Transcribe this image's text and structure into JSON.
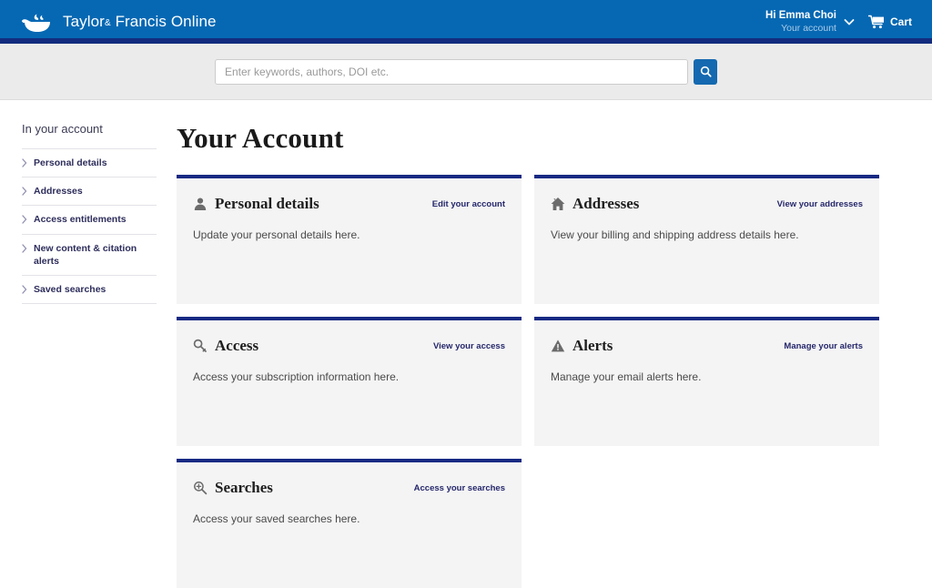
{
  "header": {
    "brand_name": "Taylor",
    "brand_amp": "&",
    "brand_rest": "Francis Online",
    "logo_icon": "teacup-logo-icon",
    "account": {
      "greeting": "Hi Emma Choi",
      "subtitle": "Your account",
      "chevron_icon": "chevron-down-icon"
    },
    "cart": {
      "label": "Cart",
      "icon": "shopping-cart-icon"
    },
    "bar_color": "#0668b3",
    "underline_color": "#132c7e"
  },
  "search": {
    "placeholder": "Enter keywords, authors, DOI etc.",
    "value": "",
    "button_icon": "search-icon",
    "button_color": "#1569b0",
    "band_color": "#ebebeb"
  },
  "sidebar": {
    "title": "In your account",
    "items": [
      {
        "label": "Personal details",
        "icon": "chevron-right-icon"
      },
      {
        "label": "Addresses",
        "icon": "chevron-right-icon"
      },
      {
        "label": "Access entitlements",
        "icon": "chevron-right-icon"
      },
      {
        "label": "New content & citation alerts",
        "icon": "chevron-right-icon"
      },
      {
        "label": "Saved searches",
        "icon": "chevron-right-icon"
      }
    ]
  },
  "main": {
    "page_title": "Your Account",
    "card_border_color": "#172983",
    "card_background": "#f4f4f4",
    "cards": [
      {
        "title": "Personal details",
        "icon": "user-icon",
        "link": "Edit your account",
        "description": "Update your personal details here."
      },
      {
        "title": "Addresses",
        "icon": "home-icon",
        "link": "View your addresses",
        "description": "View your billing and shipping address details here."
      },
      {
        "title": "Access",
        "icon": "key-icon",
        "link": "View your access",
        "description": "Access your subscription information here."
      },
      {
        "title": "Alerts",
        "icon": "warning-triangle-icon",
        "link": "Manage your alerts",
        "description": "Manage your email alerts here."
      },
      {
        "title": "Searches",
        "icon": "zoom-in-icon",
        "link": "Access your searches",
        "description": "Access your saved searches here."
      }
    ]
  }
}
